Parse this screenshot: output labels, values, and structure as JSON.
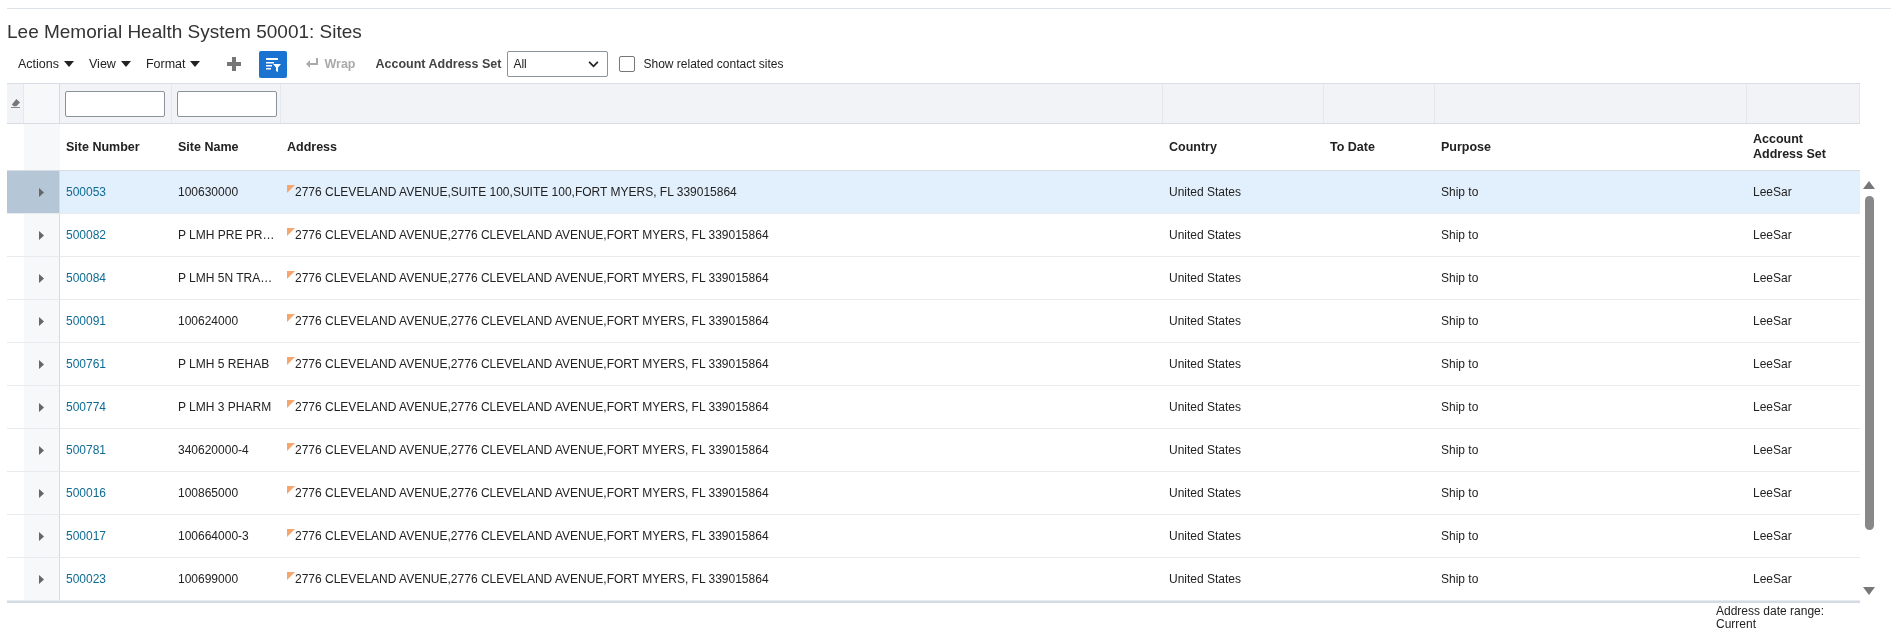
{
  "page": {
    "title": "Lee Memorial Health System 50001: Sites"
  },
  "toolbar": {
    "menus": [
      "Actions",
      "View",
      "Format"
    ],
    "wrap": {
      "label": "Wrap",
      "disabled": true
    },
    "address_set": {
      "label": "Account Address Set",
      "value": "All"
    },
    "related": {
      "label": "Show related contact sites",
      "checked": false
    }
  },
  "table": {
    "columns": [
      "Site Number",
      "Site Name",
      "Address",
      "Country",
      "To Date",
      "Purpose",
      "Account Address Set"
    ],
    "rows": [
      {
        "site_number": "500053",
        "site_name": "100630000",
        "address": "2776 CLEVELAND AVENUE,SUITE 100,SUITE 100,FORT MYERS, FL 339015864",
        "country": "United States",
        "purpose": "Ship to",
        "address_set": "LeeSar",
        "selected": true
      },
      {
        "site_number": "500082",
        "site_name": "P LMH PRE PR…",
        "address": "2776 CLEVELAND AVENUE,2776 CLEVELAND AVENUE,FORT MYERS, FL 339015864",
        "country": "United States",
        "purpose": "Ship to",
        "address_set": "LeeSar",
        "selected": false
      },
      {
        "site_number": "500084",
        "site_name": "P LMH 5N TRA…",
        "address": "2776 CLEVELAND AVENUE,2776 CLEVELAND AVENUE,FORT MYERS, FL 339015864",
        "country": "United States",
        "purpose": "Ship to",
        "address_set": "LeeSar",
        "selected": false
      },
      {
        "site_number": "500091",
        "site_name": "100624000",
        "address": "2776 CLEVELAND AVENUE,2776 CLEVELAND AVENUE,FORT MYERS, FL 339015864",
        "country": "United States",
        "purpose": "Ship to",
        "address_set": "LeeSar",
        "selected": false
      },
      {
        "site_number": "500761",
        "site_name": "P LMH 5 REHAB",
        "address": "2776 CLEVELAND AVENUE,2776 CLEVELAND AVENUE,FORT MYERS, FL 339015864",
        "country": "United States",
        "purpose": "Ship to",
        "address_set": "LeeSar",
        "selected": false
      },
      {
        "site_number": "500774",
        "site_name": "P LMH 3 PHARM",
        "address": "2776 CLEVELAND AVENUE,2776 CLEVELAND AVENUE,FORT MYERS, FL 339015864",
        "country": "United States",
        "purpose": "Ship to",
        "address_set": "LeeSar",
        "selected": false
      },
      {
        "site_number": "500781",
        "site_name": "340620000-4",
        "address": "2776 CLEVELAND AVENUE,2776 CLEVELAND AVENUE,FORT MYERS, FL 339015864",
        "country": "United States",
        "purpose": "Ship to",
        "address_set": "LeeSar",
        "selected": false
      },
      {
        "site_number": "500016",
        "site_name": "100865000",
        "address": "2776 CLEVELAND AVENUE,2776 CLEVELAND AVENUE,FORT MYERS, FL 339015864",
        "country": "United States",
        "purpose": "Ship to",
        "address_set": "LeeSar",
        "selected": false
      },
      {
        "site_number": "500017",
        "site_name": "100664000-3",
        "address": "2776 CLEVELAND AVENUE,2776 CLEVELAND AVENUE,FORT MYERS, FL 339015864",
        "country": "United States",
        "purpose": "Ship to",
        "address_set": "LeeSar",
        "selected": false
      },
      {
        "site_number": "500023",
        "site_name": "100699000",
        "address": "2776 CLEVELAND AVENUE,2776 CLEVELAND AVENUE,FORT MYERS, FL 339015864",
        "country": "United States",
        "purpose": "Ship to",
        "address_set": "LeeSar",
        "selected": false
      }
    ]
  },
  "footer": {
    "date_range_label": "Address date range:",
    "date_range_value": "Current"
  }
}
